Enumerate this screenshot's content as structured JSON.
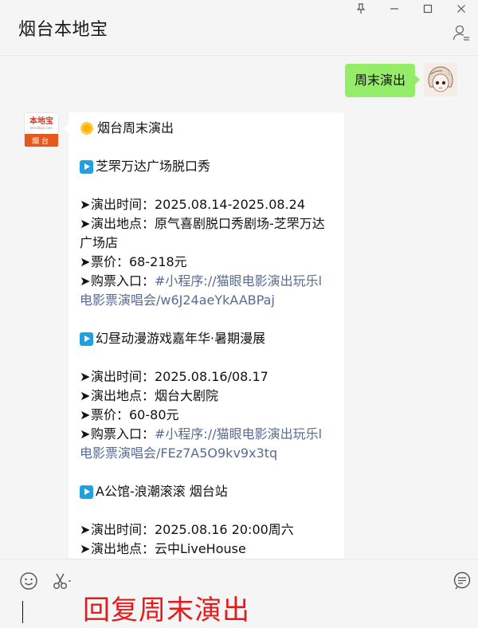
{
  "window": {
    "title": "烟台本地宝",
    "controls": [
      "pin-icon",
      "minimize-icon",
      "maximize-icon",
      "close-icon"
    ]
  },
  "chat": {
    "my_message": "周末演出",
    "bot_avatar": {
      "brand": "本地宝",
      "url": "bendibao.com",
      "city": "烟台"
    },
    "headline": "烟台周末演出",
    "shows": [
      {
        "title": "芝罘万达广场脱口秀",
        "lines": [
          "演出时间：2025.08.14-2025.08.24",
          "演出地点：原气喜剧脱口秀剧场-芝罘万达广场店",
          "票价：68-218元"
        ],
        "ticket_label": "购票入口：",
        "ticket_link": "#小程序://猫眼电影演出玩乐l电影票演唱会/w6J24aeYkAABPaj"
      },
      {
        "title": "幻昼动漫游戏嘉年华·暑期漫展",
        "lines": [
          "演出时间：2025.08.16/08.17",
          "演出地点：烟台大剧院",
          "票价：60-80元"
        ],
        "ticket_label": "购票入口：",
        "ticket_link": "#小程序://猫眼电影演出玩乐l电影票演唱会/FEz7A5O9kv9x3tq"
      },
      {
        "title": "A公馆-浪潮滚滚 烟台站",
        "lines": [
          "演出时间：2025.08.16 20:00周六",
          "演出地点：云中LiveHouse"
        ]
      }
    ]
  },
  "input": {
    "overlay_text": "回复周末演出"
  },
  "colors": {
    "my_bubble": "#95ec69",
    "link": "#576b95",
    "overlay_text": "#e21c1c",
    "play_icon": "#1da1e2"
  }
}
